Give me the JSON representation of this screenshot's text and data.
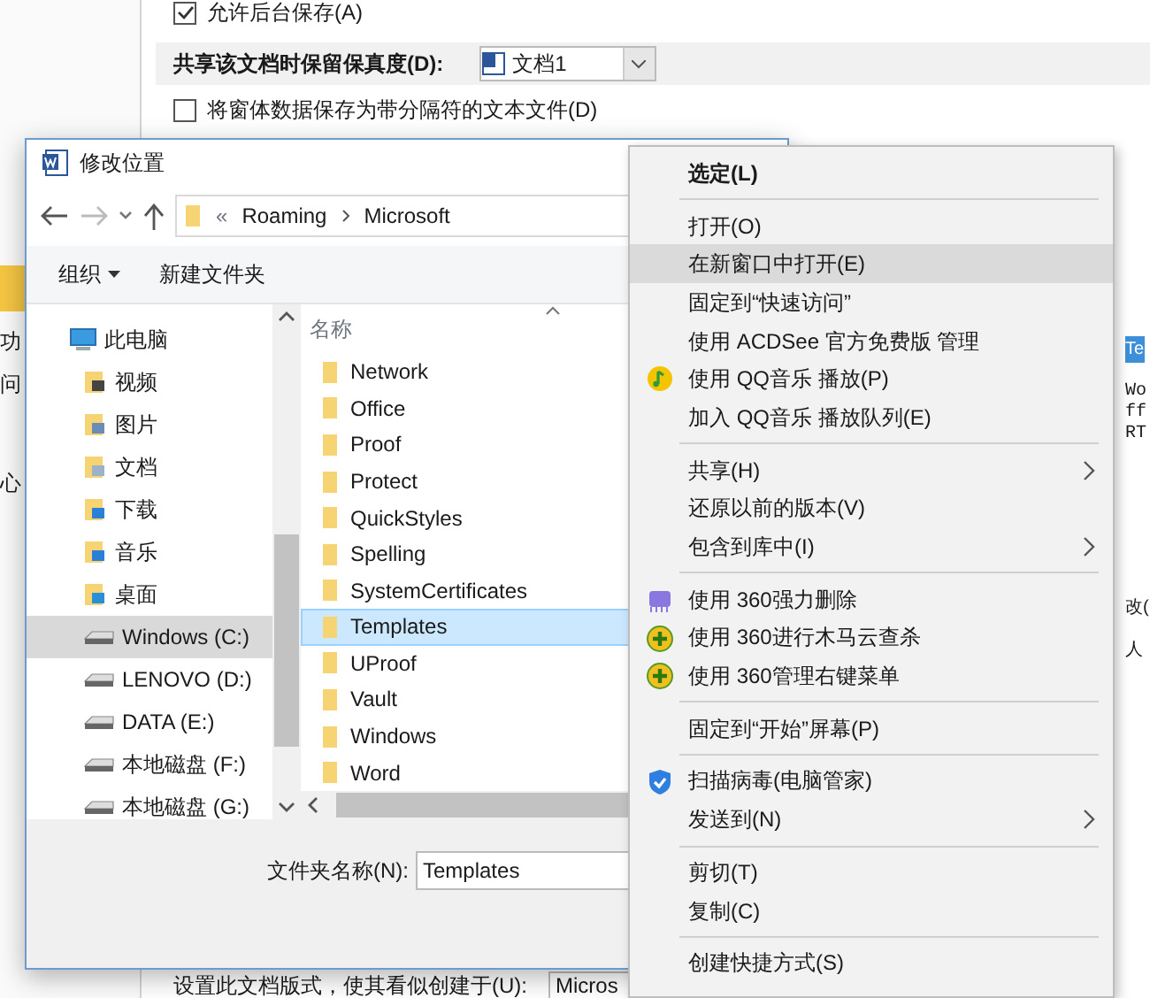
{
  "background_window": {
    "sidebar_fragments": [
      "功",
      "问",
      "心"
    ],
    "save_in_background": {
      "label": "允许后台保存(A)",
      "checked": true
    },
    "fidelity": {
      "label": "共享该文档时保留保真度(D):",
      "value": "文档1"
    },
    "save_form_data": {
      "label": "将窗体数据保存为带分隔符的文本文件(D)",
      "checked": false
    },
    "layout_option": {
      "label": "设置此文档版式，使其看似创建于(U):",
      "value": "Micros"
    },
    "right_fragments": [
      "Te",
      "Wo",
      "ff",
      "RT",
      "改(",
      "人"
    ]
  },
  "dialog": {
    "title": "修改位置",
    "address": {
      "overflow": "«",
      "path": [
        "Roaming",
        "Microsoft"
      ]
    },
    "toolbar": [
      "组织",
      "新建文件夹"
    ],
    "nav_pane": [
      {
        "label": "此电脑",
        "kind": "computer",
        "selected": false,
        "children": [
          {
            "label": "视频",
            "kind": "video",
            "selected": false
          },
          {
            "label": "图片",
            "kind": "pictures",
            "selected": false
          },
          {
            "label": "文档",
            "kind": "documents",
            "selected": false
          },
          {
            "label": "下载",
            "kind": "downloads",
            "selected": false
          },
          {
            "label": "音乐",
            "kind": "music",
            "selected": false
          },
          {
            "label": "桌面",
            "kind": "desktop",
            "selected": false
          },
          {
            "label": "Windows (C:)",
            "kind": "drive",
            "selected": true
          },
          {
            "label": "LENOVO (D:)",
            "kind": "drive",
            "selected": false
          },
          {
            "label": "DATA (E:)",
            "kind": "drive",
            "selected": false
          },
          {
            "label": "本地磁盘 (F:)",
            "kind": "drive",
            "selected": false
          },
          {
            "label": "本地磁盘 (G:)",
            "kind": "drive",
            "selected": false
          }
        ]
      }
    ],
    "file_list": {
      "column": "名称",
      "items": [
        {
          "name": "Network",
          "selected": false
        },
        {
          "name": "Office",
          "selected": false
        },
        {
          "name": "Proof",
          "selected": false
        },
        {
          "name": "Protect",
          "selected": false
        },
        {
          "name": "QuickStyles",
          "selected": false
        },
        {
          "name": "Spelling",
          "selected": false
        },
        {
          "name": "SystemCertificates",
          "selected": false
        },
        {
          "name": "Templates",
          "selected": true
        },
        {
          "name": "UProof",
          "selected": false
        },
        {
          "name": "Vault",
          "selected": false
        },
        {
          "name": "Windows",
          "selected": false
        },
        {
          "name": "Word",
          "selected": false
        }
      ]
    },
    "folder_name": {
      "label": "文件夹名称(N):",
      "value": "Templates"
    }
  },
  "context_menu": {
    "items": [
      {
        "kind": "plain",
        "label": "选定(L)",
        "default": true,
        "highlighted": false,
        "submenu": false
      },
      {
        "kind": "separator"
      },
      {
        "kind": "plain",
        "label": "打开(O)",
        "default": false,
        "highlighted": false,
        "submenu": false
      },
      {
        "kind": "plain",
        "label": "在新窗口中打开(E)",
        "default": false,
        "highlighted": true,
        "submenu": false
      },
      {
        "kind": "plain",
        "label": "固定到“快速访问”",
        "default": false,
        "highlighted": false,
        "submenu": false
      },
      {
        "kind": "plain",
        "label": "使用 ACDSee 官方免费版 管理",
        "default": false,
        "highlighted": false,
        "submenu": false
      },
      {
        "kind": "music",
        "label": "使用 QQ音乐 播放(P)",
        "default": false,
        "highlighted": false,
        "submenu": false
      },
      {
        "kind": "plain",
        "label": "加入 QQ音乐 播放队列(E)",
        "default": false,
        "highlighted": false,
        "submenu": false
      },
      {
        "kind": "separator"
      },
      {
        "kind": "plain",
        "label": "共享(H)",
        "default": false,
        "highlighted": false,
        "submenu": true
      },
      {
        "kind": "plain",
        "label": "还原以前的版本(V)",
        "default": false,
        "highlighted": false,
        "submenu": false
      },
      {
        "kind": "plain",
        "label": "包含到库中(I)",
        "default": false,
        "highlighted": false,
        "submenu": true
      },
      {
        "kind": "separator"
      },
      {
        "kind": "eraser",
        "label": "使用 360强力删除",
        "default": false,
        "highlighted": false,
        "submenu": false
      },
      {
        "kind": "plus",
        "label": "使用 360进行木马云查杀",
        "default": false,
        "highlighted": false,
        "submenu": false
      },
      {
        "kind": "plus",
        "label": "使用 360管理右键菜单",
        "default": false,
        "highlighted": false,
        "submenu": false
      },
      {
        "kind": "separator"
      },
      {
        "kind": "plain",
        "label": "固定到“开始”屏幕(P)",
        "default": false,
        "highlighted": false,
        "submenu": false
      },
      {
        "kind": "separator"
      },
      {
        "kind": "shield",
        "label": "扫描病毒(电脑管家)",
        "default": false,
        "highlighted": false,
        "submenu": false
      },
      {
        "kind": "plain",
        "label": "发送到(N)",
        "default": false,
        "highlighted": false,
        "submenu": true
      },
      {
        "kind": "separator"
      },
      {
        "kind": "plain",
        "label": "剪切(T)",
        "default": false,
        "highlighted": false,
        "submenu": false
      },
      {
        "kind": "plain",
        "label": "复制(C)",
        "default": false,
        "highlighted": false,
        "submenu": false
      },
      {
        "kind": "separator"
      },
      {
        "kind": "plain",
        "label": "创建快捷方式(S)",
        "default": false,
        "highlighted": false,
        "submenu": false
      }
    ]
  }
}
